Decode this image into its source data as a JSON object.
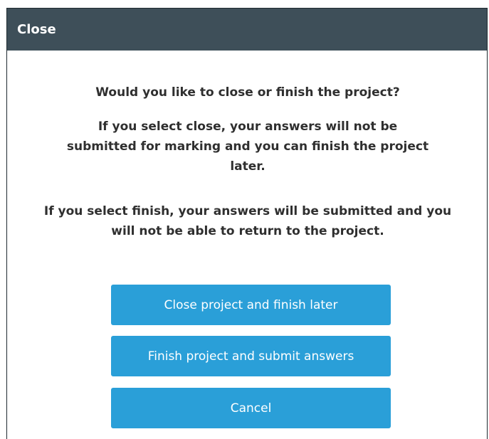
{
  "dialog": {
    "title": "Close",
    "question": "Would you like to close or finish the project?",
    "close_info": "If you select close, your answers will not be submitted for marking and you can finish the project later.",
    "finish_info": "If you select finish, your answers will be submitted and you will not be able to return to the project.",
    "buttons": {
      "close_later": "Close project and finish later",
      "finish_submit": "Finish project and submit answers",
      "cancel": "Cancel"
    }
  },
  "colors": {
    "titlebar": "#3e4f59",
    "button": "#2a9fd8",
    "text": "#2f2f2f"
  }
}
